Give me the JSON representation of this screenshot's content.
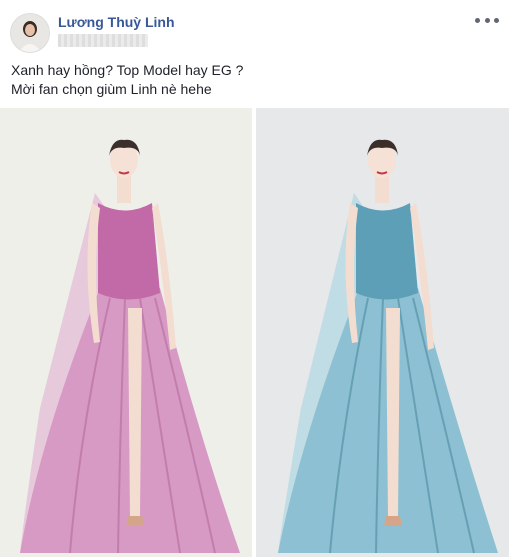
{
  "post": {
    "author": "Lương Thuỳ Linh",
    "caption_line1": "Xanh hay hồng? Top Model hay EG ?",
    "caption_line2": "Mời fan chọn giùm Linh nè hehe",
    "more_icon": "ellipsis-icon"
  },
  "photos": [
    {
      "name": "pink-gown-sketch",
      "dress_color": "#c27ab0",
      "dress_light": "#e9c3de",
      "bg": "#eeeeea"
    },
    {
      "name": "blue-gown-sketch",
      "dress_color": "#5e9fb8",
      "dress_light": "#bfe0ea",
      "bg": "#e6e8e9"
    }
  ]
}
